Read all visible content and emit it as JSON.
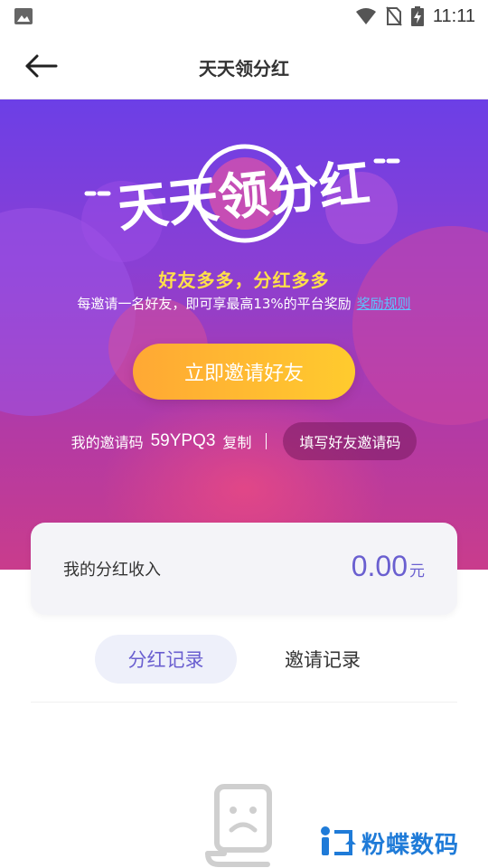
{
  "status_bar": {
    "time": "11:11",
    "icons": [
      "image-icon",
      "wifi-icon",
      "no-sim-icon",
      "battery-charging-icon"
    ]
  },
  "header": {
    "title": "天天领分红",
    "back_icon": "arrow-left-icon"
  },
  "hero": {
    "title_art": "天天领分红",
    "slogan": "好友多多，分红多多",
    "description": "每邀请一名好友，即可享最高13%的平台奖励",
    "rules_link": "奖励规则",
    "invite_button": "立即邀请好友",
    "code_label": "我的邀请码",
    "code_value": "59YPQ3",
    "copy_label": "复制",
    "fill_code_button": "填写好友邀请码"
  },
  "income": {
    "label": "我的分红收入",
    "value": "0.00",
    "unit": "元"
  },
  "tabs": [
    {
      "label": "分红记录",
      "active": true
    },
    {
      "label": "邀请记录",
      "active": false
    }
  ],
  "empty_state": {
    "icon": "sad-document-icon"
  },
  "watermark": {
    "text": "粉蝶数码"
  },
  "colors": {
    "accent": "#6a5fd0",
    "hero_top": "#6c3fe6",
    "hero_bottom": "#c93c8c",
    "button_gradient_start": "#ffa834",
    "button_gradient_end": "#ffcb2e",
    "slogan": "#ffe04a",
    "link": "#5ec2ff"
  }
}
